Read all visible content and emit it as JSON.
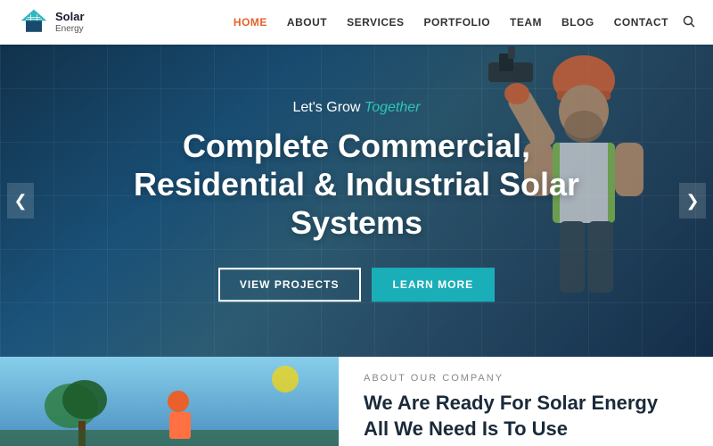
{
  "navbar": {
    "logo_solar": "Solar",
    "logo_energy": "Energy",
    "nav_items": [
      {
        "label": "HOME",
        "active": true
      },
      {
        "label": "ABOUT",
        "active": false
      },
      {
        "label": "SERVICES",
        "active": false
      },
      {
        "label": "PORTFOLIO",
        "active": false
      },
      {
        "label": "TEAM",
        "active": false
      },
      {
        "label": "BLOG",
        "active": false
      },
      {
        "label": "CONTACT",
        "active": false
      }
    ]
  },
  "hero": {
    "subtitle_plain": "Let's Grow",
    "subtitle_highlight": "Together",
    "title": "Complete Commercial, Residential & Industrial Solar Systems",
    "btn_left": "VIEW PROJECTS",
    "btn_right": "LEARN MORE",
    "arrow_left": "❮",
    "arrow_right": "❯"
  },
  "bottom": {
    "about_label": "ABOUT OUR COMPANY",
    "about_heading_plain": "We Are Ready For Solar Energy",
    "about_heading_bold": "All We Need Is To Use"
  }
}
